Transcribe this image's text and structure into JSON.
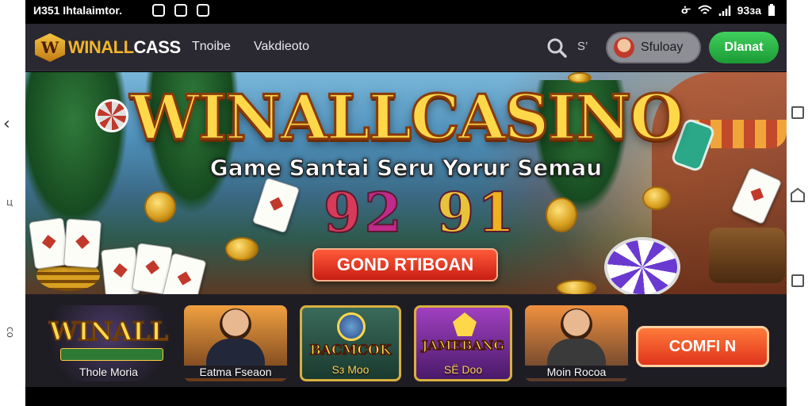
{
  "status_bar": {
    "time_text": "И351 Ihtalaimtor.",
    "battery_text": "93зa",
    "icons": [
      "notification-icon",
      "vpn-icon",
      "download-icon",
      "bluetooth-icon",
      "wifi-icon",
      "signal-icon",
      "battery-icon"
    ]
  },
  "header": {
    "logo_text_a": "WINALL",
    "logo_text_b": "CASS",
    "logo_badge": "W",
    "nav": [
      "Tnoibe",
      "Vakdieoto"
    ],
    "search_label": "S’",
    "login_label": "Sfuloay",
    "register_label": "Dlanat"
  },
  "hero": {
    "title": "WINALLCASINO",
    "subtitle": "Game Santai Seru Yorur Semau",
    "numbers": [
      "9",
      "2",
      "9",
      "1"
    ],
    "number_colors": [
      "#d83a5a",
      "#c02a8a",
      "#e8c23a",
      "#f0b020"
    ],
    "cta_label": "GOND RTIBOAN"
  },
  "games": {
    "tiles": [
      {
        "art_word": "WINALL",
        "caption": "Thole Moria"
      },
      {
        "caption": "Eatma Fseaon"
      },
      {
        "art_word": "BACMCOK",
        "caption": "Sз Moo"
      },
      {
        "art_word": "JAMEBANG",
        "caption": "SЁ Doo"
      },
      {
        "caption": "Moin Rocoa"
      }
    ],
    "cta_label": "COMFI N"
  },
  "colors": {
    "gold": "#ffd84a",
    "register_green": "#1c9a35",
    "cta_red": "#c81e14",
    "header_bg": "#2a2830"
  }
}
